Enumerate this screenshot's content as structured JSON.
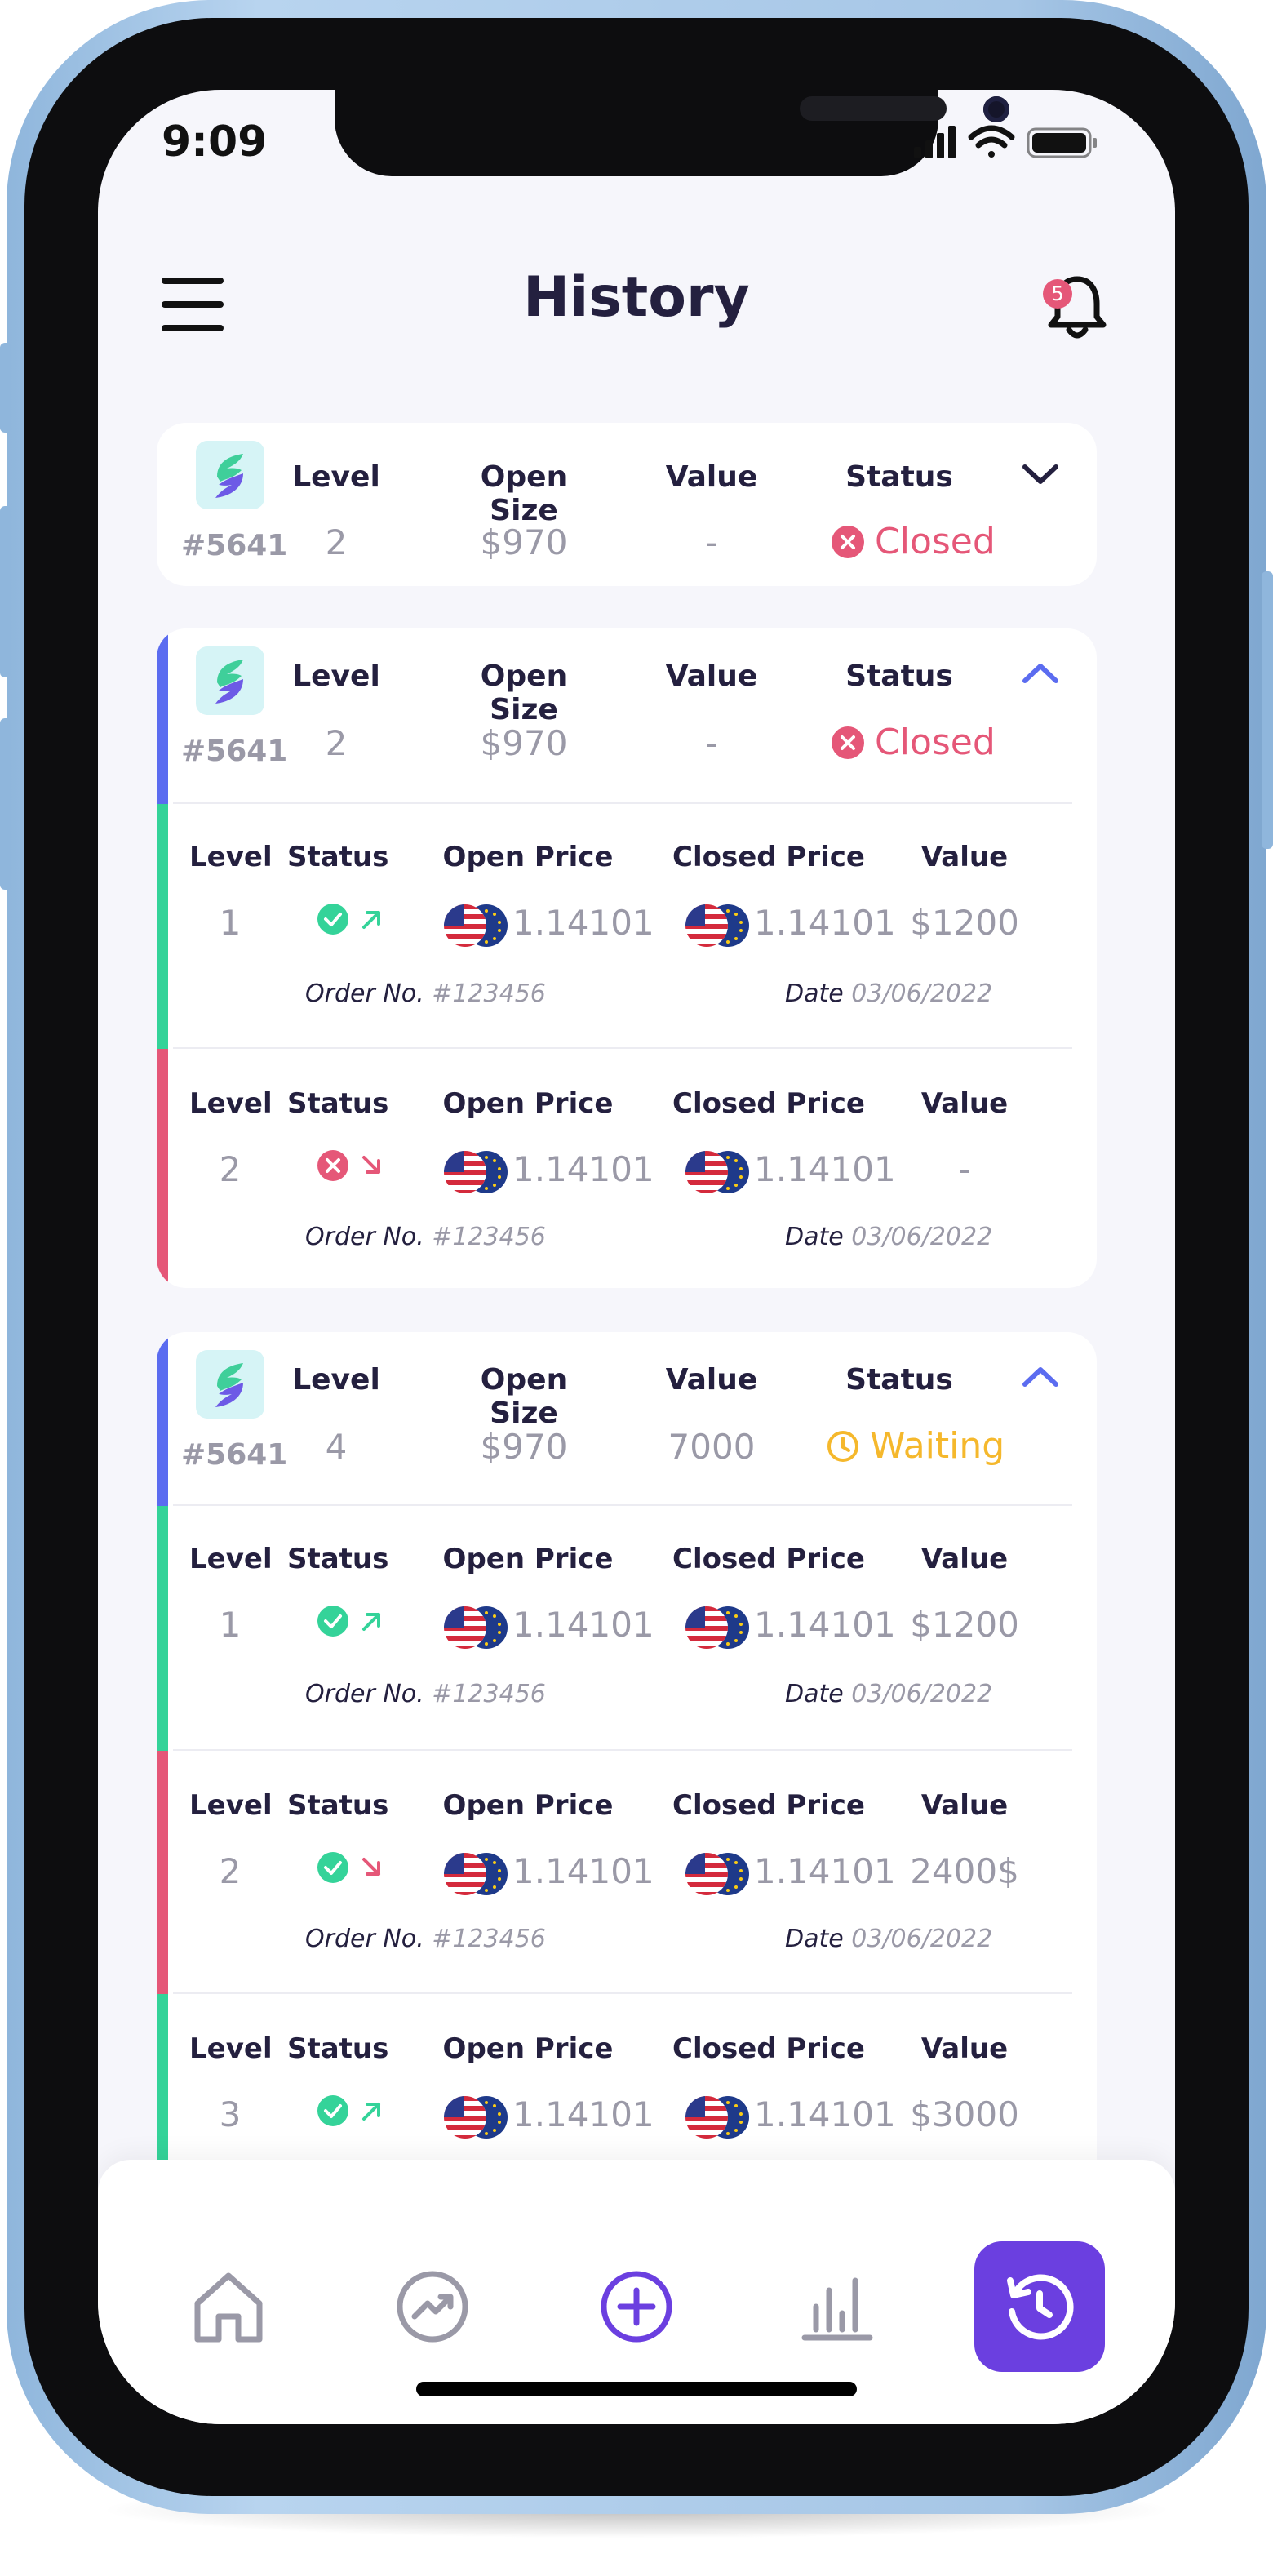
{
  "status_bar": {
    "time": "9:09"
  },
  "header": {
    "title": "History",
    "notification_count": "5"
  },
  "columns": {
    "level": "Level",
    "open_size": "Open Size",
    "value": "Value",
    "status": "Status",
    "open_price": "Open Price",
    "closed_price": "Closed Price"
  },
  "order_no_label": "Order No.",
  "date_label": "Date",
  "cards": [
    {
      "id": "#5641",
      "level": "2",
      "open_size": "$970",
      "value": "-",
      "status": "Closed",
      "expanded": false
    },
    {
      "id": "#5641",
      "level": "2",
      "open_size": "$970",
      "value": "-",
      "status": "Closed",
      "expanded": true,
      "rows": [
        {
          "level": "1",
          "status": "success",
          "direction": "up",
          "open_price": "1.14101",
          "closed_price": "1.14101",
          "value": "$1200",
          "order_no": "#123456",
          "date": "03/06/2022",
          "accent": "#34d399"
        },
        {
          "level": "2",
          "status": "failed",
          "direction": "down",
          "open_price": "1.14101",
          "closed_price": "1.14101",
          "value": "-",
          "order_no": "#123456",
          "date": "03/06/2022",
          "accent": "#e55778"
        }
      ]
    },
    {
      "id": "#5641",
      "level": "4",
      "open_size": "$970",
      "value": "7000",
      "status": "Waiting",
      "expanded": true,
      "rows": [
        {
          "level": "1",
          "status": "success",
          "direction": "up",
          "open_price": "1.14101",
          "closed_price": "1.14101",
          "value": "$1200",
          "order_no": "#123456",
          "date": "03/06/2022",
          "accent": "#34d399"
        },
        {
          "level": "2",
          "status": "success",
          "direction": "down",
          "open_price": "1.14101",
          "closed_price": "1.14101",
          "value": "2400$",
          "order_no": "#123456",
          "date": "03/06/2022",
          "accent": "#e55778"
        },
        {
          "level": "3",
          "status": "success",
          "direction": "up",
          "open_price": "1.14101",
          "closed_price": "1.14101",
          "value": "$3000",
          "accent": "#34d399"
        }
      ]
    }
  ],
  "nav": [
    "home-icon",
    "trend-icon",
    "add-icon",
    "stats-icon",
    "history-icon"
  ],
  "colors": {
    "accent_purple": "#6b3fe0",
    "closed": "#e55778",
    "waiting": "#f5b82c",
    "success": "#34d399",
    "card_accent": "#5b6cf0"
  }
}
